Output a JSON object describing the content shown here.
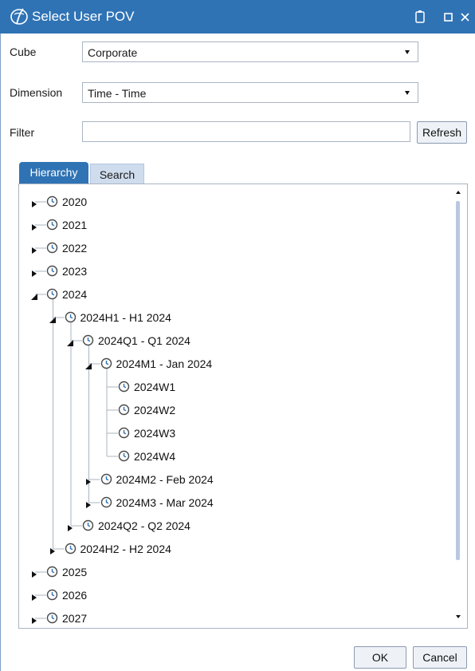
{
  "window": {
    "title": "Select User POV",
    "accent_color": "#2f73b5",
    "controls": [
      "clipboard-icon",
      "maximize-icon",
      "close-icon"
    ]
  },
  "form": {
    "cube": {
      "label": "Cube",
      "value": "Corporate"
    },
    "dimension": {
      "label": "Dimension",
      "value": "Time - Time"
    },
    "filter": {
      "label": "Filter",
      "value": "",
      "placeholder": ""
    },
    "refresh_label": "Refresh"
  },
  "tabs": [
    {
      "label": "Hierarchy",
      "active": true
    },
    {
      "label": "Search",
      "active": false
    }
  ],
  "tree": [
    {
      "label": "2020",
      "depth": 0,
      "state": "collapsed"
    },
    {
      "label": "2021",
      "depth": 0,
      "state": "collapsed"
    },
    {
      "label": "2022",
      "depth": 0,
      "state": "collapsed"
    },
    {
      "label": "2023",
      "depth": 0,
      "state": "collapsed"
    },
    {
      "label": "2024",
      "depth": 0,
      "state": "expanded"
    },
    {
      "label": "2024H1 - H1 2024",
      "depth": 1,
      "state": "expanded"
    },
    {
      "label": "2024Q1 - Q1 2024",
      "depth": 2,
      "state": "expanded"
    },
    {
      "label": "2024M1 - Jan 2024",
      "depth": 3,
      "state": "expanded"
    },
    {
      "label": "2024W1",
      "depth": 4,
      "state": "leaf"
    },
    {
      "label": "2024W2",
      "depth": 4,
      "state": "leaf"
    },
    {
      "label": "2024W3",
      "depth": 4,
      "state": "leaf"
    },
    {
      "label": "2024W4",
      "depth": 4,
      "state": "leaf"
    },
    {
      "label": "2024M2 - Feb 2024",
      "depth": 3,
      "state": "collapsed"
    },
    {
      "label": "2024M3 - Mar 2024",
      "depth": 3,
      "state": "collapsed"
    },
    {
      "label": "2024Q2 - Q2 2024",
      "depth": 2,
      "state": "collapsed"
    },
    {
      "label": "2024H2 - H2 2024",
      "depth": 1,
      "state": "collapsed"
    },
    {
      "label": "2025",
      "depth": 0,
      "state": "collapsed"
    },
    {
      "label": "2026",
      "depth": 0,
      "state": "collapsed"
    },
    {
      "label": "2027",
      "depth": 0,
      "state": "collapsed"
    }
  ],
  "buttons": {
    "ok_label": "OK",
    "cancel_label": "Cancel"
  }
}
